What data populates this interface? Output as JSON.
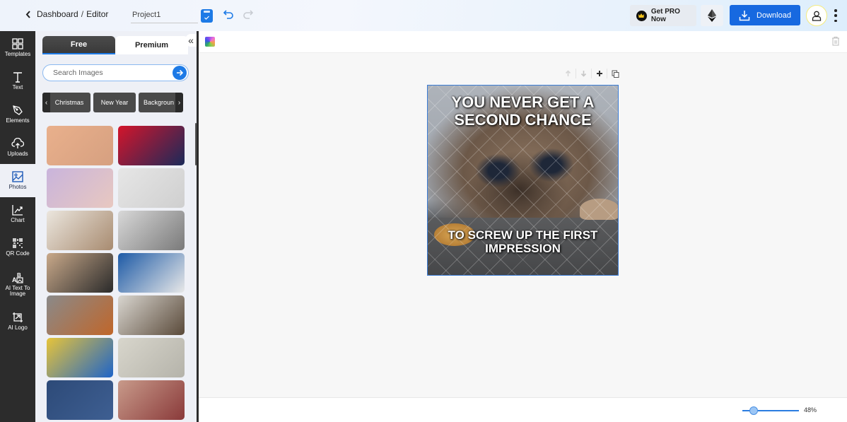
{
  "header": {
    "breadcrumb": [
      "Dashboard",
      "Editor"
    ],
    "breadcrumb_separator": "/",
    "project_name": "Project1",
    "pro_button": "Get PRO Now",
    "download_button": "Download",
    "accent": "#1769e0"
  },
  "sidebar": {
    "items": [
      {
        "label": "Templates",
        "icon": "templates-icon"
      },
      {
        "label": "Text",
        "icon": "text-icon"
      },
      {
        "label": "Elements",
        "icon": "elements-icon"
      },
      {
        "label": "Uploads",
        "icon": "uploads-icon"
      },
      {
        "label": "Photos",
        "icon": "photos-icon",
        "active": true
      },
      {
        "label": "Chart",
        "icon": "chart-icon"
      },
      {
        "label": "QR Code",
        "icon": "qr-code-icon"
      },
      {
        "label": "AI Text To Image",
        "icon": "ai-text-to-image-icon"
      },
      {
        "label": "AI Logo",
        "icon": "ai-logo-icon"
      }
    ]
  },
  "panel": {
    "tabs": [
      {
        "label": "Free",
        "active": true
      },
      {
        "label": "Premium"
      }
    ],
    "search_placeholder": "Search Images",
    "categories": [
      "Christmas",
      "New Year",
      "Backgroun"
    ],
    "photos": [
      {
        "name": "ocean-sunset",
        "colors": [
          "#e9b08c",
          "#d6a080"
        ]
      },
      {
        "name": "neon-sign",
        "colors": [
          "#d4152b",
          "#1a2a5a"
        ]
      },
      {
        "name": "pastel-fabric",
        "colors": [
          "#c9b4dc",
          "#e8c8c0"
        ]
      },
      {
        "name": "sneakers-notebook",
        "colors": [
          "#e6e6e6",
          "#cfcfcf"
        ]
      },
      {
        "name": "pocket-watch",
        "colors": [
          "#ebe6de",
          "#a88b70"
        ]
      },
      {
        "name": "cameo-necklace",
        "colors": [
          "#d8d8d8",
          "#7a7a7a"
        ]
      },
      {
        "name": "chess-pieces",
        "colors": [
          "#c9a98a",
          "#2a2a2a"
        ]
      },
      {
        "name": "teamwork-hands",
        "colors": [
          "#1d5aa6",
          "#e8e8e8"
        ]
      },
      {
        "name": "grilled-chicken",
        "colors": [
          "#8a8a8a",
          "#c0662a"
        ]
      },
      {
        "name": "watch-on-sand",
        "colors": [
          "#d9d6d0",
          "#5a4a3a"
        ]
      },
      {
        "name": "shirts-rack",
        "colors": [
          "#e7c43a",
          "#1e64c8"
        ]
      },
      {
        "name": "laptop",
        "colors": [
          "#d8d6cc",
          "#b5b3aa"
        ]
      },
      {
        "name": "denim",
        "colors": [
          "#2d4a78",
          "#3e5f92"
        ]
      },
      {
        "name": "color-swatches",
        "colors": [
          "#c89a8a",
          "#8a3a3a"
        ]
      }
    ]
  },
  "canvas": {
    "meme_top": "YOU NEVER GET A SECOND CHANCE",
    "meme_bottom": "TO SCREW UP THE FIRST IMPRESSION"
  },
  "zoom": {
    "value_percent": 48,
    "label": "48%"
  }
}
